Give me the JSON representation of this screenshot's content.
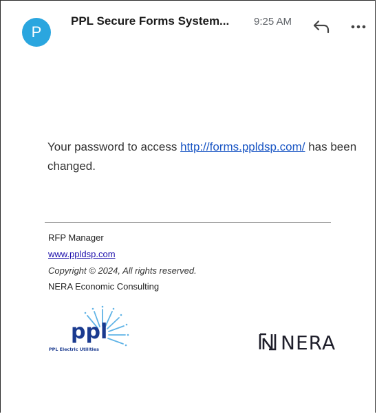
{
  "email": {
    "avatar_letter": "P",
    "sender": "PPL Secure Forms System...",
    "time": "9:25 AM",
    "body_prefix": "Your password to access ",
    "body_link": "http://forms.ppldsp.com/",
    "body_suffix": " has been changed."
  },
  "signature": {
    "manager": "RFP Manager",
    "website": "www.ppldsp.com",
    "copyright": "Copyright © 2024, All rights reserved.",
    "company": "NERA Economic Consulting"
  },
  "logos": {
    "ppl_text": "ppl",
    "ppl_caption": "PPL Electric Utilities",
    "nera_text": "NERA"
  },
  "colors": {
    "avatar": "#2aa6df",
    "link": "#1a56c4",
    "ppl_blue": "#1a3a8f",
    "ppl_light": "#5fb3e6"
  },
  "icons": {
    "reply": "reply-arrow-icon",
    "more": "more-horizontal-icon"
  }
}
